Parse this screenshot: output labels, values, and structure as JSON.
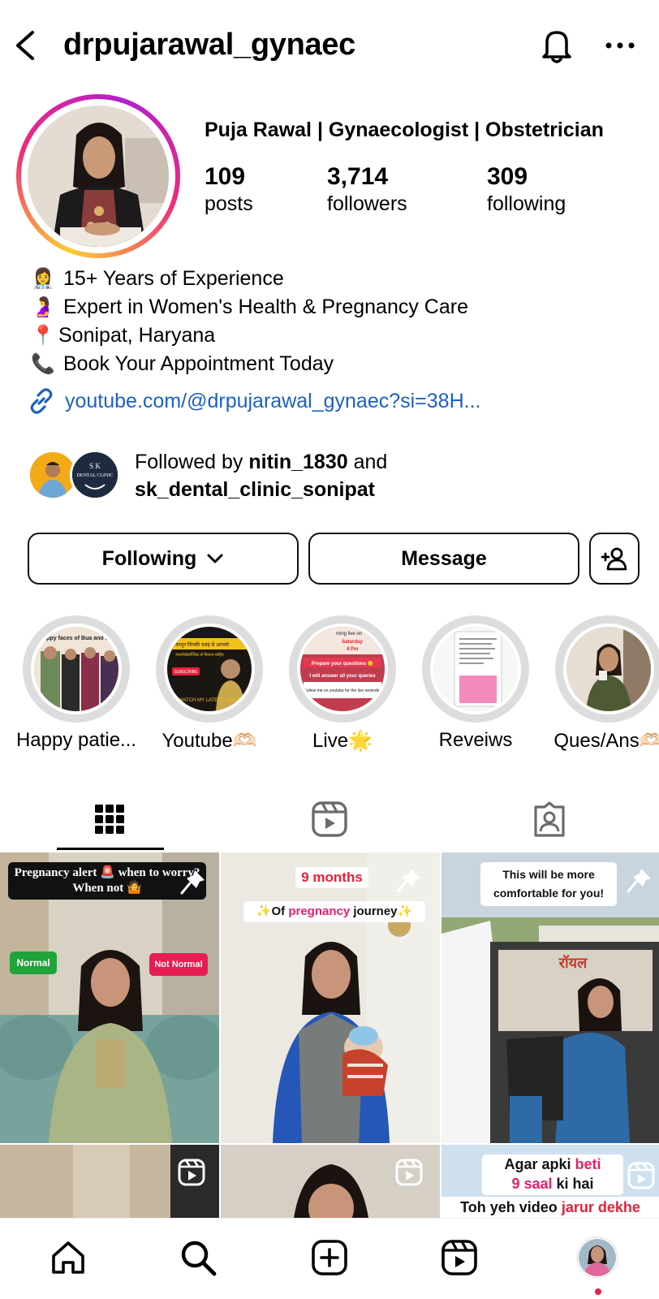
{
  "header": {
    "username": "drpujarawal_gynaec",
    "icons": {
      "back": "back-icon",
      "notifications": "bell-icon",
      "more": "more-icon"
    }
  },
  "profile": {
    "full_name": "Puja Rawal | Gynaecologist | Obstetrician",
    "stats": [
      {
        "num": "109",
        "label": "posts"
      },
      {
        "num": "3,714",
        "label": "followers"
      },
      {
        "num": "309",
        "label": "following"
      }
    ],
    "bio": [
      {
        "emoji": "👩‍⚕️",
        "text": "15+ Years of Experience"
      },
      {
        "emoji": "🤰",
        "text": "Expert in Women's Health & Pregnancy Care"
      },
      {
        "emoji": "📍",
        "text": "Sonipat, Haryana"
      },
      {
        "emoji": "📞",
        "text": "Book Your Appointment Today"
      }
    ],
    "link": "youtube.com/@drpujarawal_gynaec?si=38H...",
    "followed_by": {
      "prefix": "Followed by ",
      "user1": "nitin_1830",
      "middle": " and",
      "user2": "sk_dental_clinic_sonipat"
    }
  },
  "actions": {
    "following_label": "Following",
    "message_label": "Message"
  },
  "highlights": [
    {
      "label": "Happy patie..."
    },
    {
      "label": "Youtube🫶🏻"
    },
    {
      "label": "Live🌟"
    },
    {
      "label": "Reveiws"
    },
    {
      "label": "Ques/Ans🫶🏻"
    }
  ],
  "highlight_texts": {
    "h1": "appy faces of Bua and D",
    "h2a": "ज कानून जिनकी वजह से आपको",
    "h2b": "गायनेकोलॉजिस्ट से मिलना चाहिए",
    "h2c": "SUBSCRIBE",
    "h2d": "WATCH MY LATEST VIDEO",
    "h3a": "ming live on",
    "h3b": "Saturday",
    "h3c": "4 Pm",
    "h3d": "Prepare your questions 🙂",
    "h3e": "I will answer all your queries",
    "h3f": "Follow me on youtube for the live reminder"
  },
  "tabs": [
    {
      "name": "grid",
      "icon": "grid-icon"
    },
    {
      "name": "reels",
      "icon": "reels-icon"
    },
    {
      "name": "tagged",
      "icon": "tagged-icon"
    }
  ],
  "posts": {
    "p1": {
      "title": "Pregnancy alert 🚨 when to worry? When not 🤷",
      "tag1": "Normal",
      "tag2": "Not Normal"
    },
    "p2": {
      "title": "9 months",
      "sub_pre": "✨Of ",
      "sub_hl": "pregnancy",
      "sub_post": " journey✨"
    },
    "p3": {
      "title": "This will be more comfortable for you!",
      "sign": "रॉयल"
    },
    "p6": {
      "l1_pre": "Agar apki ",
      "l1_hl": "beti",
      "l2_hl": "9 saal",
      "l2_post": " ki hai",
      "l3_pre": "Toh yeh video ",
      "l3_hl": "jarur dekhe"
    }
  },
  "bottom_nav": [
    "home-icon",
    "search-icon",
    "create-icon",
    "reels-icon",
    "profile-avatar"
  ],
  "colors": {
    "link": "#1b61c4",
    "accent_pink": "#e8204a",
    "tag_green": "#1fa33a",
    "tag_red": "#e71d52"
  }
}
